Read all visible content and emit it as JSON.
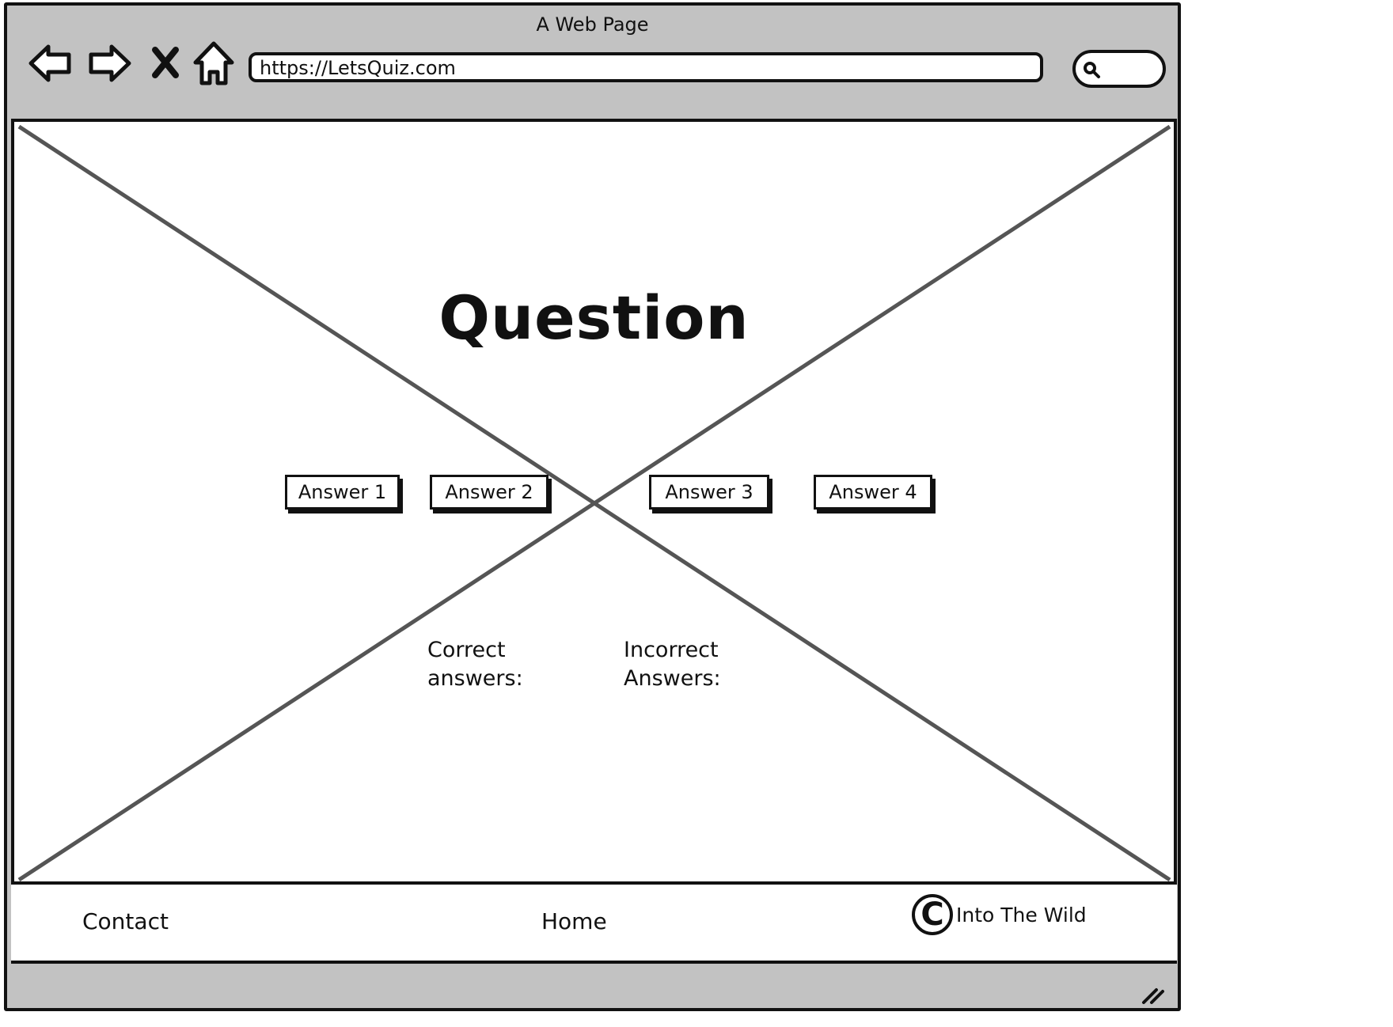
{
  "window": {
    "title": "A Web Page"
  },
  "toolbar": {
    "back_icon": "back-arrow-icon",
    "forward_icon": "forward-arrow-icon",
    "stop_icon": "close-icon",
    "home_icon": "home-icon",
    "url": "https://LetsQuiz.com",
    "search_icon": "search-icon"
  },
  "main": {
    "question": "Question",
    "answers": [
      {
        "label": "Answer 1"
      },
      {
        "label": "Answer 2"
      },
      {
        "label": "Answer 3"
      },
      {
        "label": "Answer 4"
      }
    ],
    "correct_label_line1": "Correct",
    "correct_label_line2": "answers:",
    "incorrect_label_line1": "Incorrect",
    "incorrect_label_line2": "Answers:"
  },
  "footer": {
    "contact": "Contact",
    "home": "Home",
    "copyright_symbol": "C",
    "copyright_text": "Into The Wild"
  },
  "colors": {
    "chrome": "#c2c2c2",
    "stroke": "#111111",
    "placeholder_lines": "#555555"
  }
}
